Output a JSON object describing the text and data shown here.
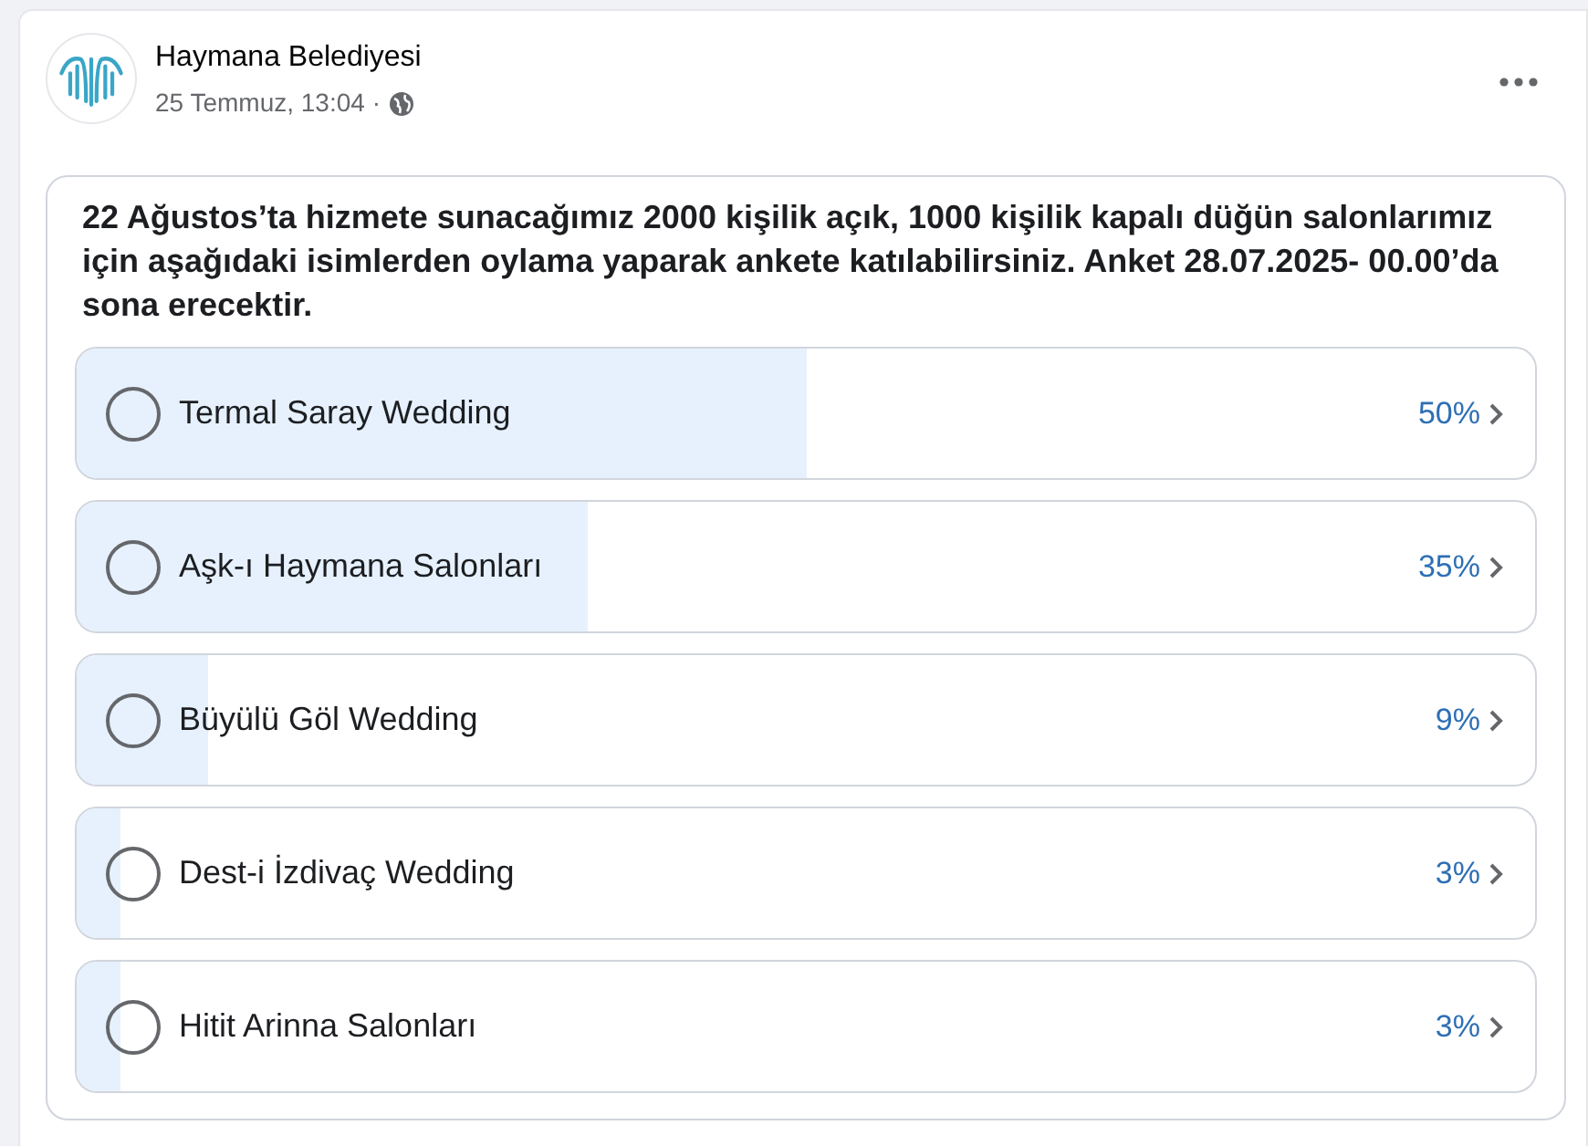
{
  "post": {
    "author": "Haymana Belediyesi",
    "timestamp": "25 Temmuz, 13:04",
    "separator": "·"
  },
  "poll": {
    "question": "22 Ağustos’ta hizmete sunacağımız 2000 kişilik açık, 1000 kişilik kapalı düğün salonlarımız için aşağıdaki isimlerden oylama yaparak ankete katılabilirsiniz. Anket 28.07.2025- 00.00’da sona erecektir.",
    "options": [
      {
        "label": "Termal Saray Wedding",
        "percent": "50%",
        "level": 0.5,
        "selected": false
      },
      {
        "label": "Aşk-ı Haymana Salonları",
        "percent": "35%",
        "level": 0.35,
        "selected": false
      },
      {
        "label": "Büyülü Göl Wedding",
        "percent": "9%",
        "level": 0.09,
        "selected": false
      },
      {
        "label": "Dest-i İzdivaç Wedding",
        "percent": "3%",
        "level": 0.03,
        "selected": false
      },
      {
        "label": "Hitit Arinna Salonları",
        "percent": "3%",
        "level": 0.03,
        "selected": false
      }
    ]
  }
}
